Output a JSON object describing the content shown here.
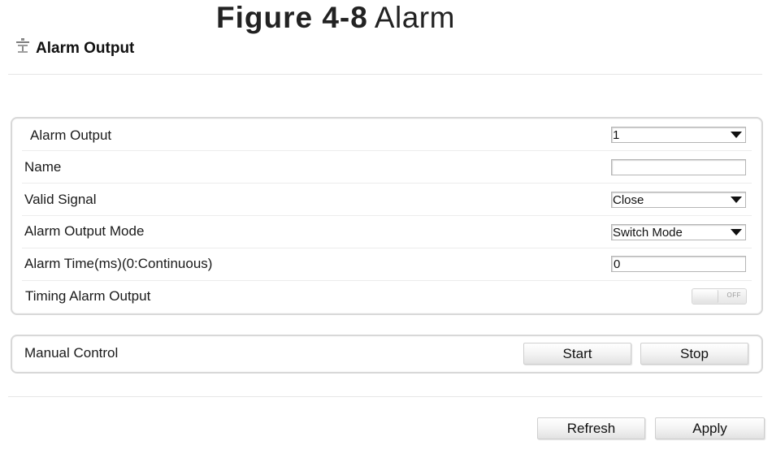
{
  "figure": {
    "number": "Figure 4-8",
    "name": "Alarm"
  },
  "header": {
    "icon": "alarm-output-icon",
    "title": "Alarm Output"
  },
  "config": {
    "alarm_output": {
      "label": "Alarm Output",
      "value": "1"
    },
    "name": {
      "label": "Name",
      "value": ""
    },
    "valid_signal": {
      "label": "Valid Signal",
      "value": "Close"
    },
    "alarm_output_mode": {
      "label": "Alarm Output Mode",
      "value": "Switch Mode"
    },
    "alarm_time": {
      "label": "Alarm Time(ms)(0:Continuous)",
      "value": "0"
    },
    "timing_alarm_output": {
      "label": "Timing Alarm Output",
      "state": "OFF",
      "enabled": false
    }
  },
  "manual": {
    "label": "Manual Control",
    "start_label": "Start",
    "stop_label": "Stop"
  },
  "footer": {
    "refresh_label": "Refresh",
    "apply_label": "Apply"
  }
}
